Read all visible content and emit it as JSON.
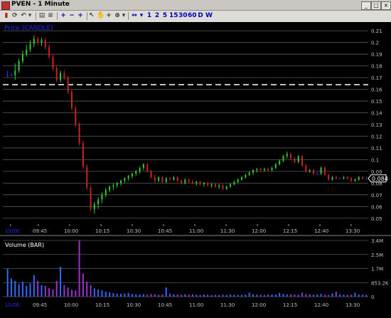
{
  "window": {
    "title": "PVEN - 1 Minute",
    "minimize_glyph": "_",
    "maximize_glyph": "□",
    "close_glyph": "×"
  },
  "toolbar": {
    "buttons": [
      {
        "name": "cursor-icon",
        "glyph": "↖"
      },
      {
        "name": "hand-icon",
        "glyph": "✋"
      },
      {
        "name": "crosshair-icon",
        "glyph": "+"
      },
      {
        "name": "zoom-icon",
        "glyph": "⊕"
      },
      {
        "name": "dropdown-icon",
        "glyph": "▾"
      }
    ],
    "intervals": [
      "1",
      "2",
      "5",
      "15",
      "30",
      "60",
      "D",
      "W"
    ]
  },
  "colors": {
    "up": "#33cc33",
    "down": "#cc2222",
    "flat": "#2244ff",
    "volume_up": "#3366ff",
    "volume_down": "#9933cc",
    "grid": "#5a5a5a",
    "axis_text": "#c0c0c0",
    "label_blue": "#1a2bff"
  },
  "price_panel": {
    "label": "Price (CANDLE)",
    "current_price_tag": "0.084",
    "y_ticks": [
      "0.21",
      "0.2",
      "0.19",
      "0.18",
      "0.17",
      "0.16",
      "0.15",
      "0.14",
      "0.13",
      "0.12",
      "0.11",
      "0.1",
      "0.09",
      "0.08",
      "0.07",
      "0.06",
      "0.05"
    ],
    "dashed_line_value": 0.164
  },
  "volume_panel": {
    "label": "Volume (BAR)",
    "y_ticks": [
      "3.4M",
      "2.5M",
      "1.7M",
      "853.2K",
      "0"
    ]
  },
  "x_axis": {
    "labels": [
      "10/26",
      "09:45",
      "10:00",
      "10:15",
      "10:30",
      "10:45",
      "11:00",
      "11:30",
      "12:00",
      "12:15",
      "12:40",
      "13:30"
    ]
  },
  "chart_data": {
    "type": "candlestick",
    "symbol": "PVEN",
    "ylim": [
      0.045,
      0.215
    ],
    "volume_ylim": [
      0,
      3400000
    ],
    "candles": [
      {
        "o": 0.172,
        "h": 0.176,
        "l": 0.17,
        "c": 0.172
      },
      {
        "o": 0.172,
        "h": 0.174,
        "l": 0.171,
        "c": 0.172
      },
      {
        "o": 0.172,
        "h": 0.182,
        "l": 0.168,
        "c": 0.176
      },
      {
        "o": 0.176,
        "h": 0.186,
        "l": 0.174,
        "c": 0.184
      },
      {
        "o": 0.184,
        "h": 0.193,
        "l": 0.182,
        "c": 0.19
      },
      {
        "o": 0.19,
        "h": 0.198,
        "l": 0.188,
        "c": 0.194
      },
      {
        "o": 0.194,
        "h": 0.202,
        "l": 0.192,
        "c": 0.199
      },
      {
        "o": 0.199,
        "h": 0.206,
        "l": 0.196,
        "c": 0.203
      },
      {
        "o": 0.203,
        "h": 0.205,
        "l": 0.198,
        "c": 0.2
      },
      {
        "o": 0.2,
        "h": 0.204,
        "l": 0.197,
        "c": 0.202
      },
      {
        "o": 0.202,
        "h": 0.204,
        "l": 0.194,
        "c": 0.196
      },
      {
        "o": 0.196,
        "h": 0.198,
        "l": 0.186,
        "c": 0.188
      },
      {
        "o": 0.188,
        "h": 0.19,
        "l": 0.176,
        "c": 0.178
      },
      {
        "o": 0.178,
        "h": 0.18,
        "l": 0.166,
        "c": 0.168
      },
      {
        "o": 0.168,
        "h": 0.176,
        "l": 0.166,
        "c": 0.174
      },
      {
        "o": 0.174,
        "h": 0.176,
        "l": 0.168,
        "c": 0.17
      },
      {
        "o": 0.17,
        "h": 0.172,
        "l": 0.156,
        "c": 0.158
      },
      {
        "o": 0.158,
        "h": 0.16,
        "l": 0.142,
        "c": 0.144
      },
      {
        "o": 0.144,
        "h": 0.146,
        "l": 0.128,
        "c": 0.13
      },
      {
        "o": 0.13,
        "h": 0.132,
        "l": 0.112,
        "c": 0.114
      },
      {
        "o": 0.114,
        "h": 0.116,
        "l": 0.092,
        "c": 0.094
      },
      {
        "o": 0.094,
        "h": 0.096,
        "l": 0.074,
        "c": 0.076
      },
      {
        "o": 0.076,
        "h": 0.078,
        "l": 0.056,
        "c": 0.058
      },
      {
        "o": 0.058,
        "h": 0.064,
        "l": 0.054,
        "c": 0.062
      },
      {
        "o": 0.062,
        "h": 0.068,
        "l": 0.058,
        "c": 0.066
      },
      {
        "o": 0.066,
        "h": 0.072,
        "l": 0.063,
        "c": 0.07
      },
      {
        "o": 0.07,
        "h": 0.076,
        "l": 0.068,
        "c": 0.074
      },
      {
        "o": 0.074,
        "h": 0.078,
        "l": 0.072,
        "c": 0.077
      },
      {
        "o": 0.077,
        "h": 0.08,
        "l": 0.074,
        "c": 0.078
      },
      {
        "o": 0.078,
        "h": 0.081,
        "l": 0.076,
        "c": 0.08
      },
      {
        "o": 0.08,
        "h": 0.083,
        "l": 0.078,
        "c": 0.082
      },
      {
        "o": 0.082,
        "h": 0.085,
        "l": 0.08,
        "c": 0.084
      },
      {
        "o": 0.084,
        "h": 0.087,
        "l": 0.082,
        "c": 0.086
      },
      {
        "o": 0.086,
        "h": 0.089,
        "l": 0.084,
        "c": 0.088
      },
      {
        "o": 0.088,
        "h": 0.091,
        "l": 0.086,
        "c": 0.09
      },
      {
        "o": 0.09,
        "h": 0.094,
        "l": 0.088,
        "c": 0.093
      },
      {
        "o": 0.093,
        "h": 0.097,
        "l": 0.091,
        "c": 0.096
      },
      {
        "o": 0.096,
        "h": 0.097,
        "l": 0.089,
        "c": 0.09
      },
      {
        "o": 0.09,
        "h": 0.091,
        "l": 0.084,
        "c": 0.085
      },
      {
        "o": 0.085,
        "h": 0.087,
        "l": 0.08,
        "c": 0.082
      },
      {
        "o": 0.082,
        "h": 0.086,
        "l": 0.081,
        "c": 0.085
      },
      {
        "o": 0.085,
        "h": 0.086,
        "l": 0.08,
        "c": 0.081
      },
      {
        "o": 0.081,
        "h": 0.085,
        "l": 0.08,
        "c": 0.084
      },
      {
        "o": 0.084,
        "h": 0.085,
        "l": 0.082,
        "c": 0.083
      },
      {
        "o": 0.083,
        "h": 0.086,
        "l": 0.082,
        "c": 0.085
      },
      {
        "o": 0.085,
        "h": 0.086,
        "l": 0.081,
        "c": 0.082
      },
      {
        "o": 0.082,
        "h": 0.083,
        "l": 0.079,
        "c": 0.08
      },
      {
        "o": 0.08,
        "h": 0.084,
        "l": 0.079,
        "c": 0.083
      },
      {
        "o": 0.083,
        "h": 0.084,
        "l": 0.08,
        "c": 0.081
      },
      {
        "o": 0.081,
        "h": 0.083,
        "l": 0.079,
        "c": 0.08
      },
      {
        "o": 0.08,
        "h": 0.082,
        "l": 0.078,
        "c": 0.081
      },
      {
        "o": 0.081,
        "h": 0.082,
        "l": 0.078,
        "c": 0.079
      },
      {
        "o": 0.079,
        "h": 0.081,
        "l": 0.077,
        "c": 0.08
      },
      {
        "o": 0.08,
        "h": 0.081,
        "l": 0.077,
        "c": 0.078
      },
      {
        "o": 0.078,
        "h": 0.08,
        "l": 0.076,
        "c": 0.079
      },
      {
        "o": 0.079,
        "h": 0.08,
        "l": 0.076,
        "c": 0.077
      },
      {
        "o": 0.077,
        "h": 0.079,
        "l": 0.075,
        "c": 0.078
      },
      {
        "o": 0.078,
        "h": 0.079,
        "l": 0.074,
        "c": 0.075
      },
      {
        "o": 0.075,
        "h": 0.078,
        "l": 0.074,
        "c": 0.077
      },
      {
        "o": 0.077,
        "h": 0.08,
        "l": 0.076,
        "c": 0.079
      },
      {
        "o": 0.079,
        "h": 0.082,
        "l": 0.078,
        "c": 0.081
      },
      {
        "o": 0.081,
        "h": 0.084,
        "l": 0.08,
        "c": 0.083
      },
      {
        "o": 0.083,
        "h": 0.086,
        "l": 0.082,
        "c": 0.085
      },
      {
        "o": 0.085,
        "h": 0.088,
        "l": 0.084,
        "c": 0.087
      },
      {
        "o": 0.087,
        "h": 0.09,
        "l": 0.086,
        "c": 0.089
      },
      {
        "o": 0.089,
        "h": 0.092,
        "l": 0.087,
        "c": 0.091
      },
      {
        "o": 0.091,
        "h": 0.093,
        "l": 0.089,
        "c": 0.092
      },
      {
        "o": 0.092,
        "h": 0.093,
        "l": 0.09,
        "c": 0.091
      },
      {
        "o": 0.091,
        "h": 0.093,
        "l": 0.09,
        "c": 0.092
      },
      {
        "o": 0.092,
        "h": 0.093,
        "l": 0.09,
        "c": 0.091
      },
      {
        "o": 0.091,
        "h": 0.094,
        "l": 0.09,
        "c": 0.093
      },
      {
        "o": 0.093,
        "h": 0.097,
        "l": 0.092,
        "c": 0.096
      },
      {
        "o": 0.096,
        "h": 0.1,
        "l": 0.095,
        "c": 0.099
      },
      {
        "o": 0.099,
        "h": 0.104,
        "l": 0.098,
        "c": 0.103
      },
      {
        "o": 0.103,
        "h": 0.107,
        "l": 0.101,
        "c": 0.105
      },
      {
        "o": 0.105,
        "h": 0.106,
        "l": 0.1,
        "c": 0.101
      },
      {
        "o": 0.101,
        "h": 0.102,
        "l": 0.097,
        "c": 0.098
      },
      {
        "o": 0.098,
        "h": 0.104,
        "l": 0.097,
        "c": 0.103
      },
      {
        "o": 0.103,
        "h": 0.104,
        "l": 0.094,
        "c": 0.095
      },
      {
        "o": 0.095,
        "h": 0.096,
        "l": 0.089,
        "c": 0.09
      },
      {
        "o": 0.09,
        "h": 0.092,
        "l": 0.089,
        "c": 0.091
      },
      {
        "o": 0.091,
        "h": 0.092,
        "l": 0.087,
        "c": 0.088
      },
      {
        "o": 0.088,
        "h": 0.089,
        "l": 0.087,
        "c": 0.088
      },
      {
        "o": 0.088,
        "h": 0.094,
        "l": 0.087,
        "c": 0.093
      },
      {
        "o": 0.093,
        "h": 0.094,
        "l": 0.086,
        "c": 0.087
      },
      {
        "o": 0.087,
        "h": 0.088,
        "l": 0.082,
        "c": 0.083
      },
      {
        "o": 0.083,
        "h": 0.086,
        "l": 0.082,
        "c": 0.085
      },
      {
        "o": 0.085,
        "h": 0.086,
        "l": 0.083,
        "c": 0.084
      },
      {
        "o": 0.084,
        "h": 0.085,
        "l": 0.083,
        "c": 0.084
      },
      {
        "o": 0.084,
        "h": 0.086,
        "l": 0.083,
        "c": 0.085
      },
      {
        "o": 0.085,
        "h": 0.086,
        "l": 0.083,
        "c": 0.084
      },
      {
        "o": 0.084,
        "h": 0.085,
        "l": 0.081,
        "c": 0.082
      },
      {
        "o": 0.082,
        "h": 0.084,
        "l": 0.081,
        "c": 0.083
      },
      {
        "o": 0.083,
        "h": 0.086,
        "l": 0.082,
        "c": 0.085
      },
      {
        "o": 0.085,
        "h": 0.086,
        "l": 0.083,
        "c": 0.084
      },
      {
        "o": 0.084,
        "h": 0.085,
        "l": 0.083,
        "c": 0.084
      }
    ],
    "volume": [
      1700000,
      1100000,
      950000,
      750000,
      900000,
      650000,
      800000,
      1300000,
      950000,
      700000,
      650000,
      520000,
      450000,
      950000,
      1800000,
      700000,
      550000,
      420000,
      380000,
      3400000,
      1400000,
      900000,
      700000,
      500000,
      430000,
      380000,
      300000,
      260000,
      220000,
      180000,
      170000,
      190000,
      230000,
      160000,
      140000,
      130000,
      150000,
      120000,
      160000,
      140000,
      110000,
      130000,
      550000,
      180000,
      140000,
      130000,
      110000,
      150000,
      120000,
      140000,
      110000,
      100000,
      130000,
      120000,
      100000,
      110000,
      90000,
      120000,
      100000,
      130000,
      110000,
      95000,
      105000,
      120000,
      240000,
      130000,
      120000,
      110000,
      100000,
      140000,
      130000,
      120000,
      230000,
      170000,
      140000,
      150000,
      130000,
      110000,
      240000,
      160000,
      140000,
      120000,
      130000,
      170000,
      120000,
      110000,
      200000,
      300000,
      140000,
      120000,
      110000,
      110000,
      240000,
      130000,
      120000,
      110000
    ]
  }
}
